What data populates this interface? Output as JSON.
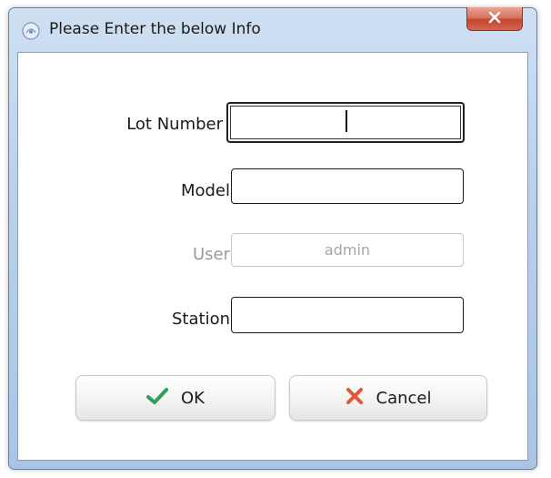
{
  "window": {
    "title": "Please Enter the below Info",
    "app_icon": "app-logo-icon",
    "close_icon": "close-icon"
  },
  "form": {
    "lot_number": {
      "label": "Lot Number",
      "value": ""
    },
    "model": {
      "label": "Model",
      "value": ""
    },
    "user": {
      "label": "User",
      "value": "admin",
      "enabled": false
    },
    "station": {
      "label": "Station",
      "value": ""
    }
  },
  "buttons": {
    "ok": {
      "label": "OK",
      "icon": "checkmark-icon",
      "icon_color": "#2e9e5b"
    },
    "cancel": {
      "label": "Cancel",
      "icon": "x-icon",
      "icon_color": "#e0573c"
    }
  }
}
